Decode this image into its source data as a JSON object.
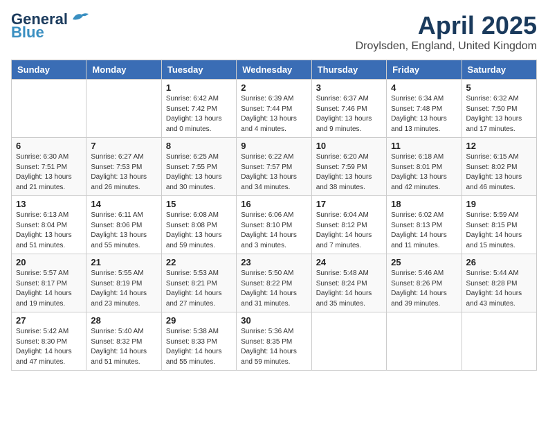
{
  "logo": {
    "line1": "General",
    "line2": "Blue"
  },
  "title": "April 2025",
  "subtitle": "Droylsden, England, United Kingdom",
  "weekdays": [
    "Sunday",
    "Monday",
    "Tuesday",
    "Wednesday",
    "Thursday",
    "Friday",
    "Saturday"
  ],
  "weeks": [
    [
      {
        "day": "",
        "info": ""
      },
      {
        "day": "",
        "info": ""
      },
      {
        "day": "1",
        "info": "Sunrise: 6:42 AM\nSunset: 7:42 PM\nDaylight: 13 hours and 0 minutes."
      },
      {
        "day": "2",
        "info": "Sunrise: 6:39 AM\nSunset: 7:44 PM\nDaylight: 13 hours and 4 minutes."
      },
      {
        "day": "3",
        "info": "Sunrise: 6:37 AM\nSunset: 7:46 PM\nDaylight: 13 hours and 9 minutes."
      },
      {
        "day": "4",
        "info": "Sunrise: 6:34 AM\nSunset: 7:48 PM\nDaylight: 13 hours and 13 minutes."
      },
      {
        "day": "5",
        "info": "Sunrise: 6:32 AM\nSunset: 7:50 PM\nDaylight: 13 hours and 17 minutes."
      }
    ],
    [
      {
        "day": "6",
        "info": "Sunrise: 6:30 AM\nSunset: 7:51 PM\nDaylight: 13 hours and 21 minutes."
      },
      {
        "day": "7",
        "info": "Sunrise: 6:27 AM\nSunset: 7:53 PM\nDaylight: 13 hours and 26 minutes."
      },
      {
        "day": "8",
        "info": "Sunrise: 6:25 AM\nSunset: 7:55 PM\nDaylight: 13 hours and 30 minutes."
      },
      {
        "day": "9",
        "info": "Sunrise: 6:22 AM\nSunset: 7:57 PM\nDaylight: 13 hours and 34 minutes."
      },
      {
        "day": "10",
        "info": "Sunrise: 6:20 AM\nSunset: 7:59 PM\nDaylight: 13 hours and 38 minutes."
      },
      {
        "day": "11",
        "info": "Sunrise: 6:18 AM\nSunset: 8:01 PM\nDaylight: 13 hours and 42 minutes."
      },
      {
        "day": "12",
        "info": "Sunrise: 6:15 AM\nSunset: 8:02 PM\nDaylight: 13 hours and 46 minutes."
      }
    ],
    [
      {
        "day": "13",
        "info": "Sunrise: 6:13 AM\nSunset: 8:04 PM\nDaylight: 13 hours and 51 minutes."
      },
      {
        "day": "14",
        "info": "Sunrise: 6:11 AM\nSunset: 8:06 PM\nDaylight: 13 hours and 55 minutes."
      },
      {
        "day": "15",
        "info": "Sunrise: 6:08 AM\nSunset: 8:08 PM\nDaylight: 13 hours and 59 minutes."
      },
      {
        "day": "16",
        "info": "Sunrise: 6:06 AM\nSunset: 8:10 PM\nDaylight: 14 hours and 3 minutes."
      },
      {
        "day": "17",
        "info": "Sunrise: 6:04 AM\nSunset: 8:12 PM\nDaylight: 14 hours and 7 minutes."
      },
      {
        "day": "18",
        "info": "Sunrise: 6:02 AM\nSunset: 8:13 PM\nDaylight: 14 hours and 11 minutes."
      },
      {
        "day": "19",
        "info": "Sunrise: 5:59 AM\nSunset: 8:15 PM\nDaylight: 14 hours and 15 minutes."
      }
    ],
    [
      {
        "day": "20",
        "info": "Sunrise: 5:57 AM\nSunset: 8:17 PM\nDaylight: 14 hours and 19 minutes."
      },
      {
        "day": "21",
        "info": "Sunrise: 5:55 AM\nSunset: 8:19 PM\nDaylight: 14 hours and 23 minutes."
      },
      {
        "day": "22",
        "info": "Sunrise: 5:53 AM\nSunset: 8:21 PM\nDaylight: 14 hours and 27 minutes."
      },
      {
        "day": "23",
        "info": "Sunrise: 5:50 AM\nSunset: 8:22 PM\nDaylight: 14 hours and 31 minutes."
      },
      {
        "day": "24",
        "info": "Sunrise: 5:48 AM\nSunset: 8:24 PM\nDaylight: 14 hours and 35 minutes."
      },
      {
        "day": "25",
        "info": "Sunrise: 5:46 AM\nSunset: 8:26 PM\nDaylight: 14 hours and 39 minutes."
      },
      {
        "day": "26",
        "info": "Sunrise: 5:44 AM\nSunset: 8:28 PM\nDaylight: 14 hours and 43 minutes."
      }
    ],
    [
      {
        "day": "27",
        "info": "Sunrise: 5:42 AM\nSunset: 8:30 PM\nDaylight: 14 hours and 47 minutes."
      },
      {
        "day": "28",
        "info": "Sunrise: 5:40 AM\nSunset: 8:32 PM\nDaylight: 14 hours and 51 minutes."
      },
      {
        "day": "29",
        "info": "Sunrise: 5:38 AM\nSunset: 8:33 PM\nDaylight: 14 hours and 55 minutes."
      },
      {
        "day": "30",
        "info": "Sunrise: 5:36 AM\nSunset: 8:35 PM\nDaylight: 14 hours and 59 minutes."
      },
      {
        "day": "",
        "info": ""
      },
      {
        "day": "",
        "info": ""
      },
      {
        "day": "",
        "info": ""
      }
    ]
  ]
}
